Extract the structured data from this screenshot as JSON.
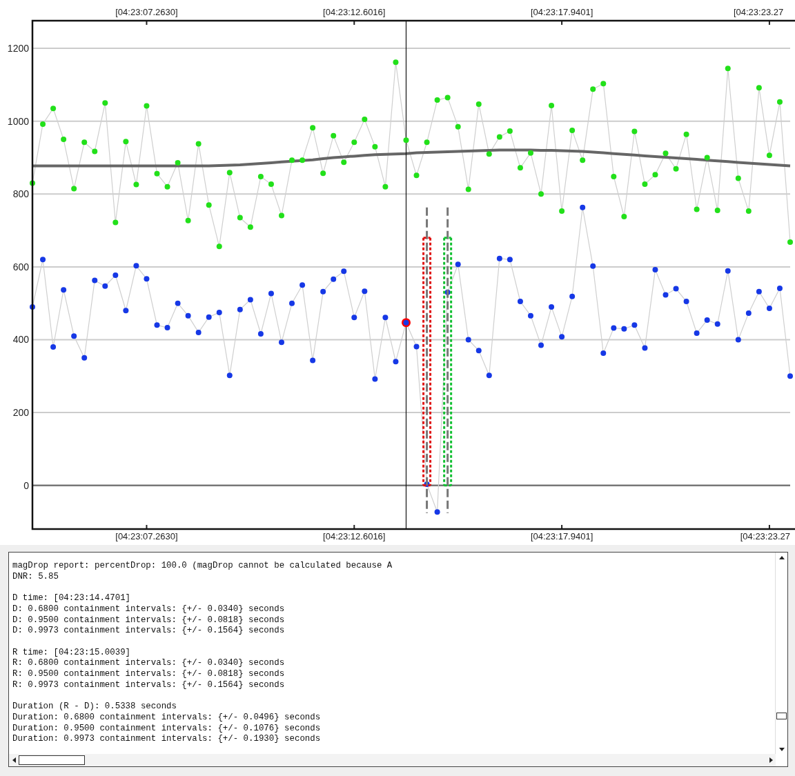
{
  "chart": {
    "top_time_labels": [
      "[04:23:07.2630]",
      "[04:23:12.6016]",
      "[04:23:17.9401]",
      "[04:23:23.27"
    ],
    "chart_data": {
      "type": "line",
      "grid": true,
      "ylim": [
        -120,
        1276
      ],
      "yticks": [
        0,
        200,
        400,
        600,
        800,
        1000,
        1200
      ],
      "categories": [
        null,
        null,
        null,
        null,
        null,
        null,
        null,
        null,
        null,
        null,
        null,
        "[04:23:07.2630]",
        null,
        null,
        null,
        null,
        null,
        null,
        null,
        null,
        null,
        null,
        null,
        null,
        null,
        null,
        null,
        null,
        null,
        null,
        null,
        "[04:23:12.6016]",
        null,
        null,
        null,
        null,
        null,
        null,
        null,
        null,
        null,
        null,
        null,
        null,
        null,
        null,
        null,
        null,
        null,
        null,
        null,
        "[04:23:17.9401]",
        null,
        null,
        null,
        null,
        null,
        null,
        null,
        null,
        null,
        null,
        null,
        null,
        null,
        null,
        null,
        null,
        null,
        null,
        null,
        "[04:23:23.27",
        null,
        null
      ],
      "series": [
        {
          "marker": "circle",
          "color": "#22e01a",
          "values": [
            830,
            992,
            1035,
            950,
            815,
            942,
            917,
            1050,
            722,
            944,
            826,
            1042,
            856,
            820,
            886,
            727,
            938,
            770,
            656,
            859,
            735,
            709,
            848,
            827,
            741,
            893,
            893,
            982,
            857,
            960,
            887,
            942,
            1005,
            930,
            820,
            1162,
            948,
            851,
            942,
            1058,
            1065,
            985,
            813,
            1047,
            910,
            957,
            973,
            872,
            913,
            800,
            1043,
            753,
            975,
            893,
            1088,
            1103,
            848,
            738,
            972,
            827,
            853,
            912,
            869,
            964,
            758,
            900,
            755,
            1145,
            843,
            753,
            1092,
            906,
            1053,
            668
          ]
        },
        {
          "marker": "circle",
          "color": "#1638e6",
          "values": [
            490,
            620,
            380,
            537,
            410,
            350,
            563,
            547,
            577,
            480,
            603,
            567,
            440,
            433,
            500,
            466,
            420,
            462,
            475,
            302,
            483,
            510,
            416,
            527,
            393,
            500,
            550,
            343,
            532,
            566,
            588,
            461,
            533,
            292,
            461,
            340,
            447,
            381,
            3,
            -73,
            530,
            607,
            400,
            370,
            302,
            623,
            620,
            505,
            466,
            385,
            490,
            408,
            519,
            763,
            602,
            363,
            432,
            430,
            440,
            377,
            592,
            523,
            540,
            505,
            418,
            454,
            443,
            589,
            400,
            473,
            532,
            486,
            541,
            300
          ]
        },
        {
          "marker": "circle",
          "color": "#ff0000",
          "values": [
            null,
            null,
            null,
            null,
            null,
            null,
            null,
            null,
            null,
            null,
            null,
            null,
            null,
            null,
            null,
            null,
            null,
            null,
            null,
            null,
            null,
            null,
            null,
            null,
            null,
            null,
            null,
            null,
            null,
            null,
            null,
            null,
            null,
            null,
            null,
            null,
            447,
            null,
            null,
            null,
            null,
            null,
            null,
            null,
            null,
            null,
            null,
            null,
            null,
            null,
            null,
            null,
            null,
            null,
            null,
            null,
            null,
            null,
            null,
            null,
            null,
            null,
            null,
            null,
            null,
            null,
            null,
            null,
            null,
            null,
            null,
            null,
            null,
            null
          ]
        },
        {
          "color": "#666666",
          "values": [
            877,
            877,
            877,
            877,
            877,
            877,
            877,
            877,
            877,
            877,
            877,
            877,
            877,
            877,
            877,
            877,
            877,
            877,
            878,
            879,
            880,
            882,
            884,
            886,
            888,
            890,
            892,
            894,
            897,
            900,
            902,
            904,
            906,
            908,
            909,
            910,
            911,
            913,
            914,
            915,
            916,
            917,
            918,
            919,
            920,
            921,
            921,
            921,
            921,
            920,
            920,
            919,
            918,
            917,
            915,
            913,
            911,
            909,
            907,
            905,
            903,
            901,
            899,
            897,
            895,
            893,
            891,
            889,
            887,
            885,
            883,
            881,
            879,
            877
          ]
        }
      ]
    }
  },
  "report": {
    "paragraphs": [
      [
        "magDrop report: percentDrop: 100.0 (magDrop cannot be calculated because A",
        "DNR: 5.85"
      ],
      [
        "D time: [04:23:14.4701]",
        "D: 0.6800 containment intervals: {+/- 0.0340} seconds",
        "D: 0.9500 containment intervals: {+/- 0.0818} seconds",
        "D: 0.9973 containment intervals: {+/- 0.1564} seconds"
      ],
      [
        "R time: [04:23:15.0039]",
        "R: 0.6800 containment intervals: {+/- 0.0340} seconds",
        "R: 0.9500 containment intervals: {+/- 0.0818} seconds",
        "R: 0.9973 containment intervals: {+/- 0.1564} seconds"
      ],
      [
        "Duration (R - D): 0.5338 seconds",
        "Duration: 0.6800 containment intervals: {+/- 0.0496} seconds",
        "Duration: 0.9500 containment intervals: {+/- 0.1076} seconds",
        "Duration: 0.9973 containment intervals: {+/- 0.1930} seconds"
      ]
    ]
  }
}
